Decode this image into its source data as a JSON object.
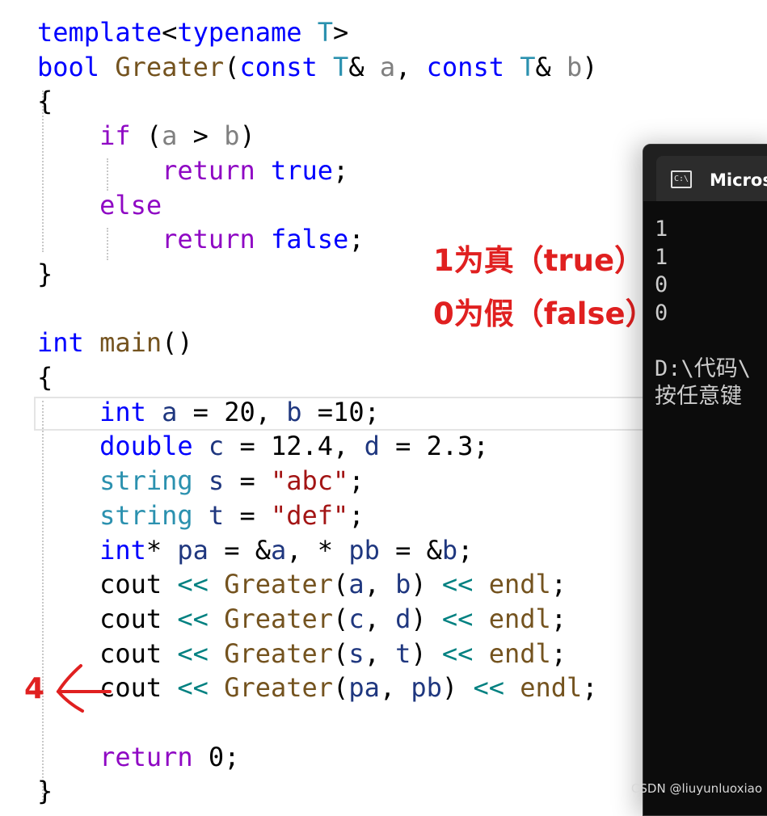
{
  "colors": {
    "keyword": "#0000ff",
    "control": "#8f08c4",
    "type": "#2b91af",
    "function": "#74531f",
    "param": "#808080",
    "variable": "#1f377f",
    "string": "#a31515",
    "operator": "#008080",
    "text": "#000000"
  },
  "code": {
    "lines": [
      [
        {
          "t": "template",
          "c": "keyword"
        },
        {
          "t": "<",
          "c": "text"
        },
        {
          "t": "typename",
          "c": "keyword"
        },
        {
          "t": " ",
          "c": "text"
        },
        {
          "t": "T",
          "c": "type"
        },
        {
          "t": ">",
          "c": "text"
        }
      ],
      [
        {
          "t": "bool",
          "c": "keyword"
        },
        {
          "t": " ",
          "c": "text"
        },
        {
          "t": "Greater",
          "c": "function"
        },
        {
          "t": "(",
          "c": "text"
        },
        {
          "t": "const",
          "c": "keyword"
        },
        {
          "t": " ",
          "c": "text"
        },
        {
          "t": "T",
          "c": "type"
        },
        {
          "t": "& ",
          "c": "text"
        },
        {
          "t": "a",
          "c": "param"
        },
        {
          "t": ", ",
          "c": "text"
        },
        {
          "t": "const",
          "c": "keyword"
        },
        {
          "t": " ",
          "c": "text"
        },
        {
          "t": "T",
          "c": "type"
        },
        {
          "t": "& ",
          "c": "text"
        },
        {
          "t": "b",
          "c": "param"
        },
        {
          "t": ")",
          "c": "text"
        }
      ],
      [
        {
          "t": "{",
          "c": "text"
        }
      ],
      [
        {
          "t": "    ",
          "c": "text"
        },
        {
          "t": "if",
          "c": "control"
        },
        {
          "t": " (",
          "c": "text"
        },
        {
          "t": "a",
          "c": "param"
        },
        {
          "t": " > ",
          "c": "text"
        },
        {
          "t": "b",
          "c": "param"
        },
        {
          "t": ")",
          "c": "text"
        }
      ],
      [
        {
          "t": "        ",
          "c": "text"
        },
        {
          "t": "return",
          "c": "control"
        },
        {
          "t": " ",
          "c": "text"
        },
        {
          "t": "true",
          "c": "keyword"
        },
        {
          "t": ";",
          "c": "text"
        }
      ],
      [
        {
          "t": "    ",
          "c": "text"
        },
        {
          "t": "else",
          "c": "control"
        }
      ],
      [
        {
          "t": "        ",
          "c": "text"
        },
        {
          "t": "return",
          "c": "control"
        },
        {
          "t": " ",
          "c": "text"
        },
        {
          "t": "false",
          "c": "keyword"
        },
        {
          "t": ";",
          "c": "text"
        }
      ],
      [
        {
          "t": "}",
          "c": "text"
        }
      ],
      [
        {
          "t": "",
          "c": "text"
        }
      ],
      [
        {
          "t": "int",
          "c": "keyword"
        },
        {
          "t": " ",
          "c": "text"
        },
        {
          "t": "main",
          "c": "function"
        },
        {
          "t": "()",
          "c": "text"
        }
      ],
      [
        {
          "t": "{",
          "c": "text"
        }
      ],
      [
        {
          "t": "    ",
          "c": "text"
        },
        {
          "t": "int",
          "c": "keyword"
        },
        {
          "t": " ",
          "c": "text"
        },
        {
          "t": "a",
          "c": "variable"
        },
        {
          "t": " = 20, ",
          "c": "text"
        },
        {
          "t": "b",
          "c": "variable"
        },
        {
          "t": " =10;",
          "c": "text"
        }
      ],
      [
        {
          "t": "    ",
          "c": "text"
        },
        {
          "t": "double",
          "c": "keyword"
        },
        {
          "t": " ",
          "c": "text"
        },
        {
          "t": "c",
          "c": "variable"
        },
        {
          "t": " = 12.4, ",
          "c": "text"
        },
        {
          "t": "d",
          "c": "variable"
        },
        {
          "t": " = 2.3;",
          "c": "text"
        }
      ],
      [
        {
          "t": "    ",
          "c": "text"
        },
        {
          "t": "string",
          "c": "type"
        },
        {
          "t": " ",
          "c": "text"
        },
        {
          "t": "s",
          "c": "variable"
        },
        {
          "t": " = ",
          "c": "text"
        },
        {
          "t": "\"abc\"",
          "c": "string"
        },
        {
          "t": ";",
          "c": "text"
        }
      ],
      [
        {
          "t": "    ",
          "c": "text"
        },
        {
          "t": "string",
          "c": "type"
        },
        {
          "t": " ",
          "c": "text"
        },
        {
          "t": "t",
          "c": "variable"
        },
        {
          "t": " = ",
          "c": "text"
        },
        {
          "t": "\"def\"",
          "c": "string"
        },
        {
          "t": ";",
          "c": "text"
        }
      ],
      [
        {
          "t": "    ",
          "c": "text"
        },
        {
          "t": "int",
          "c": "keyword"
        },
        {
          "t": "* ",
          "c": "text"
        },
        {
          "t": "pa",
          "c": "variable"
        },
        {
          "t": " = &",
          "c": "text"
        },
        {
          "t": "a",
          "c": "variable"
        },
        {
          "t": ", * ",
          "c": "text"
        },
        {
          "t": "pb",
          "c": "variable"
        },
        {
          "t": " = &",
          "c": "text"
        },
        {
          "t": "b",
          "c": "variable"
        },
        {
          "t": ";",
          "c": "text"
        }
      ],
      [
        {
          "t": "    ",
          "c": "text"
        },
        {
          "t": "cout",
          "c": "text"
        },
        {
          "t": " ",
          "c": "text"
        },
        {
          "t": "<<",
          "c": "operator"
        },
        {
          "t": " ",
          "c": "text"
        },
        {
          "t": "Greater",
          "c": "function"
        },
        {
          "t": "(",
          "c": "text"
        },
        {
          "t": "a",
          "c": "variable"
        },
        {
          "t": ", ",
          "c": "text"
        },
        {
          "t": "b",
          "c": "variable"
        },
        {
          "t": ") ",
          "c": "text"
        },
        {
          "t": "<<",
          "c": "operator"
        },
        {
          "t": " ",
          "c": "text"
        },
        {
          "t": "endl",
          "c": "function"
        },
        {
          "t": ";",
          "c": "text"
        }
      ],
      [
        {
          "t": "    ",
          "c": "text"
        },
        {
          "t": "cout",
          "c": "text"
        },
        {
          "t": " ",
          "c": "text"
        },
        {
          "t": "<<",
          "c": "operator"
        },
        {
          "t": " ",
          "c": "text"
        },
        {
          "t": "Greater",
          "c": "function"
        },
        {
          "t": "(",
          "c": "text"
        },
        {
          "t": "c",
          "c": "variable"
        },
        {
          "t": ", ",
          "c": "text"
        },
        {
          "t": "d",
          "c": "variable"
        },
        {
          "t": ") ",
          "c": "text"
        },
        {
          "t": "<<",
          "c": "operator"
        },
        {
          "t": " ",
          "c": "text"
        },
        {
          "t": "endl",
          "c": "function"
        },
        {
          "t": ";",
          "c": "text"
        }
      ],
      [
        {
          "t": "    ",
          "c": "text"
        },
        {
          "t": "cout",
          "c": "text"
        },
        {
          "t": " ",
          "c": "text"
        },
        {
          "t": "<<",
          "c": "operator"
        },
        {
          "t": " ",
          "c": "text"
        },
        {
          "t": "Greater",
          "c": "function"
        },
        {
          "t": "(",
          "c": "text"
        },
        {
          "t": "s",
          "c": "variable"
        },
        {
          "t": ", ",
          "c": "text"
        },
        {
          "t": "t",
          "c": "variable"
        },
        {
          "t": ") ",
          "c": "text"
        },
        {
          "t": "<<",
          "c": "operator"
        },
        {
          "t": " ",
          "c": "text"
        },
        {
          "t": "endl",
          "c": "function"
        },
        {
          "t": ";",
          "c": "text"
        }
      ],
      [
        {
          "t": "    ",
          "c": "text"
        },
        {
          "t": "cout",
          "c": "text"
        },
        {
          "t": " ",
          "c": "text"
        },
        {
          "t": "<<",
          "c": "operator"
        },
        {
          "t": " ",
          "c": "text"
        },
        {
          "t": "Greater",
          "c": "function"
        },
        {
          "t": "(",
          "c": "text"
        },
        {
          "t": "pa",
          "c": "variable"
        },
        {
          "t": ", ",
          "c": "text"
        },
        {
          "t": "pb",
          "c": "variable"
        },
        {
          "t": ") ",
          "c": "text"
        },
        {
          "t": "<<",
          "c": "operator"
        },
        {
          "t": " ",
          "c": "text"
        },
        {
          "t": "endl",
          "c": "function"
        },
        {
          "t": ";",
          "c": "text"
        }
      ],
      [
        {
          "t": "",
          "c": "text"
        }
      ],
      [
        {
          "t": "    ",
          "c": "text"
        },
        {
          "t": "return",
          "c": "control"
        },
        {
          "t": " 0;",
          "c": "text"
        }
      ],
      [
        {
          "t": "}",
          "c": "text"
        }
      ]
    ]
  },
  "annotations": {
    "true_note": "1为真（true）",
    "false_note": "0为假（false）",
    "arrow_label": "4",
    "arrow_color": "#e02020"
  },
  "console": {
    "icon_text": "C:\\",
    "title": "Microsoft Visual Studio 调试控制台",
    "output": [
      "1",
      "1",
      "0",
      "0",
      "",
      "D:\\代码\\",
      "按任意键"
    ]
  },
  "watermark": "CSDN @liuyunluoxiao"
}
